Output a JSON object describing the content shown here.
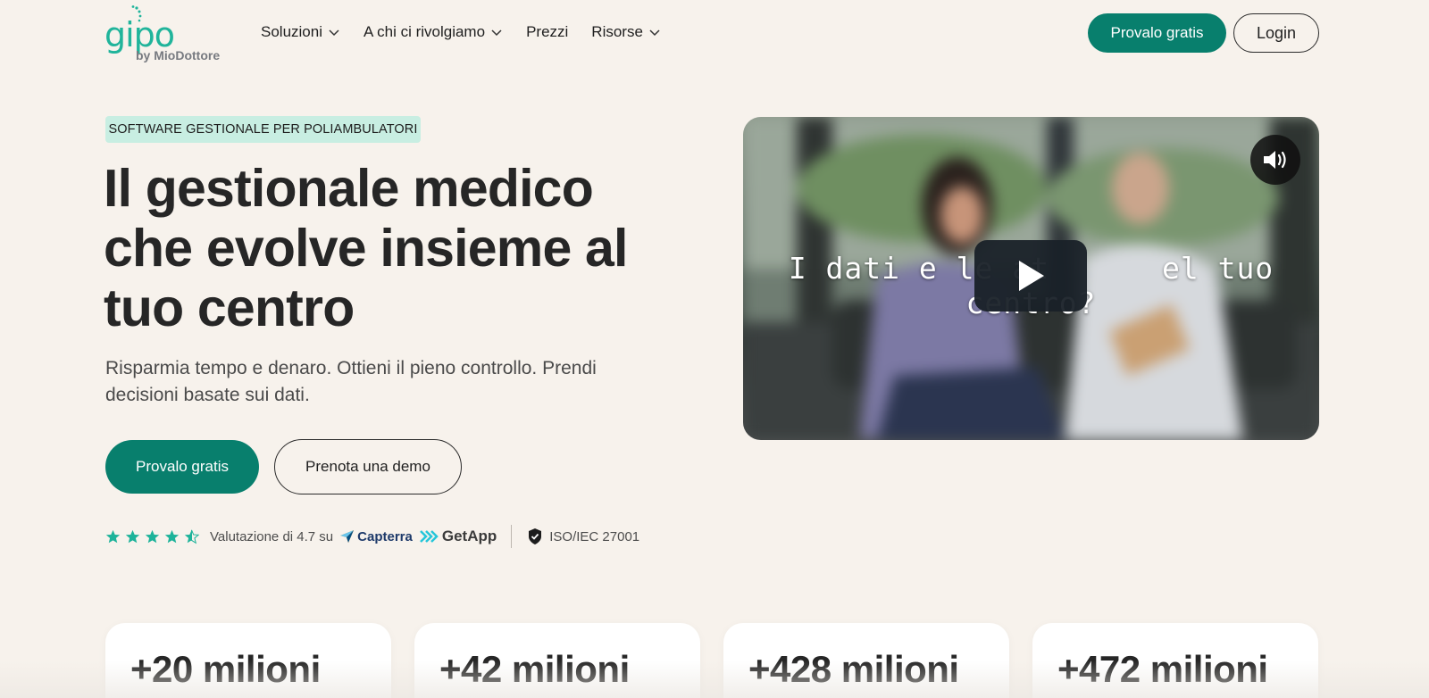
{
  "brand": {
    "logo_text": "gipo",
    "logo_sub": "by MioDottore",
    "accent_color": "#20b49b",
    "primary_color": "#087f6d"
  },
  "nav": {
    "items": [
      {
        "label": "Soluzioni",
        "has_dropdown": true
      },
      {
        "label": "A chi ci rivolgiamo",
        "has_dropdown": true
      },
      {
        "label": "Prezzi",
        "has_dropdown": false
      },
      {
        "label": "Risorse",
        "has_dropdown": true
      }
    ],
    "cta_label": "Provalo gratis",
    "login_label": "Login"
  },
  "hero": {
    "badge": "SOFTWARE GESTIONALE PER POLIAMBULATORI",
    "title_lines": [
      "Il gestionale medico",
      "che evolve insieme al",
      "tuo centro"
    ],
    "subtitle": "Risparmia tempo e denaro. Ottieni il pieno controllo. Prendi decisioni basate sui dati.",
    "cta_label": "Provalo gratis",
    "demo_label": "Prenota una demo"
  },
  "rating": {
    "stars": 4.5,
    "text": "Valutazione di 4.7 su",
    "sources": [
      "Capterra",
      "GetApp"
    ],
    "iso": "ISO/IEC 27001"
  },
  "video": {
    "caption_left": "I dati e le at",
    "caption_right": "el tuo centro?",
    "play_icon": "play-icon",
    "sound_icon": "speaker-icon"
  },
  "stats": [
    {
      "value": "+20 milioni"
    },
    {
      "value": "+42 milioni"
    },
    {
      "value": "+428 milioni"
    },
    {
      "value": "+472 milioni"
    }
  ]
}
